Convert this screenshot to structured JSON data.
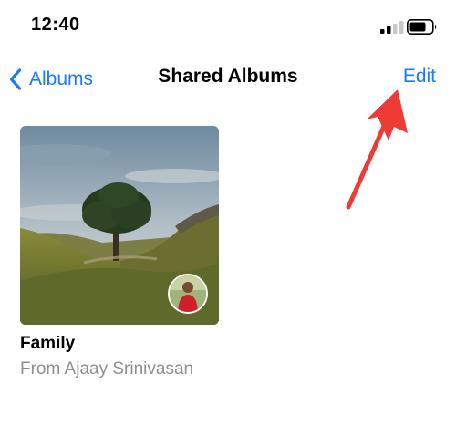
{
  "status_bar": {
    "time": "12:40",
    "signal_icon": "cellular-signal-icon",
    "battery_icon": "battery-icon"
  },
  "nav": {
    "back_label": "Albums",
    "title": "Shared Albums",
    "edit_label": "Edit",
    "back_icon": "chevron-left-icon"
  },
  "albums": [
    {
      "name": "Family",
      "owner": "From Ajaay Srinivasan"
    }
  ],
  "colors": {
    "accent": "#1a7cf0",
    "secondary_text": "#8e8e93",
    "annotation_arrow": "#ef3b36"
  }
}
